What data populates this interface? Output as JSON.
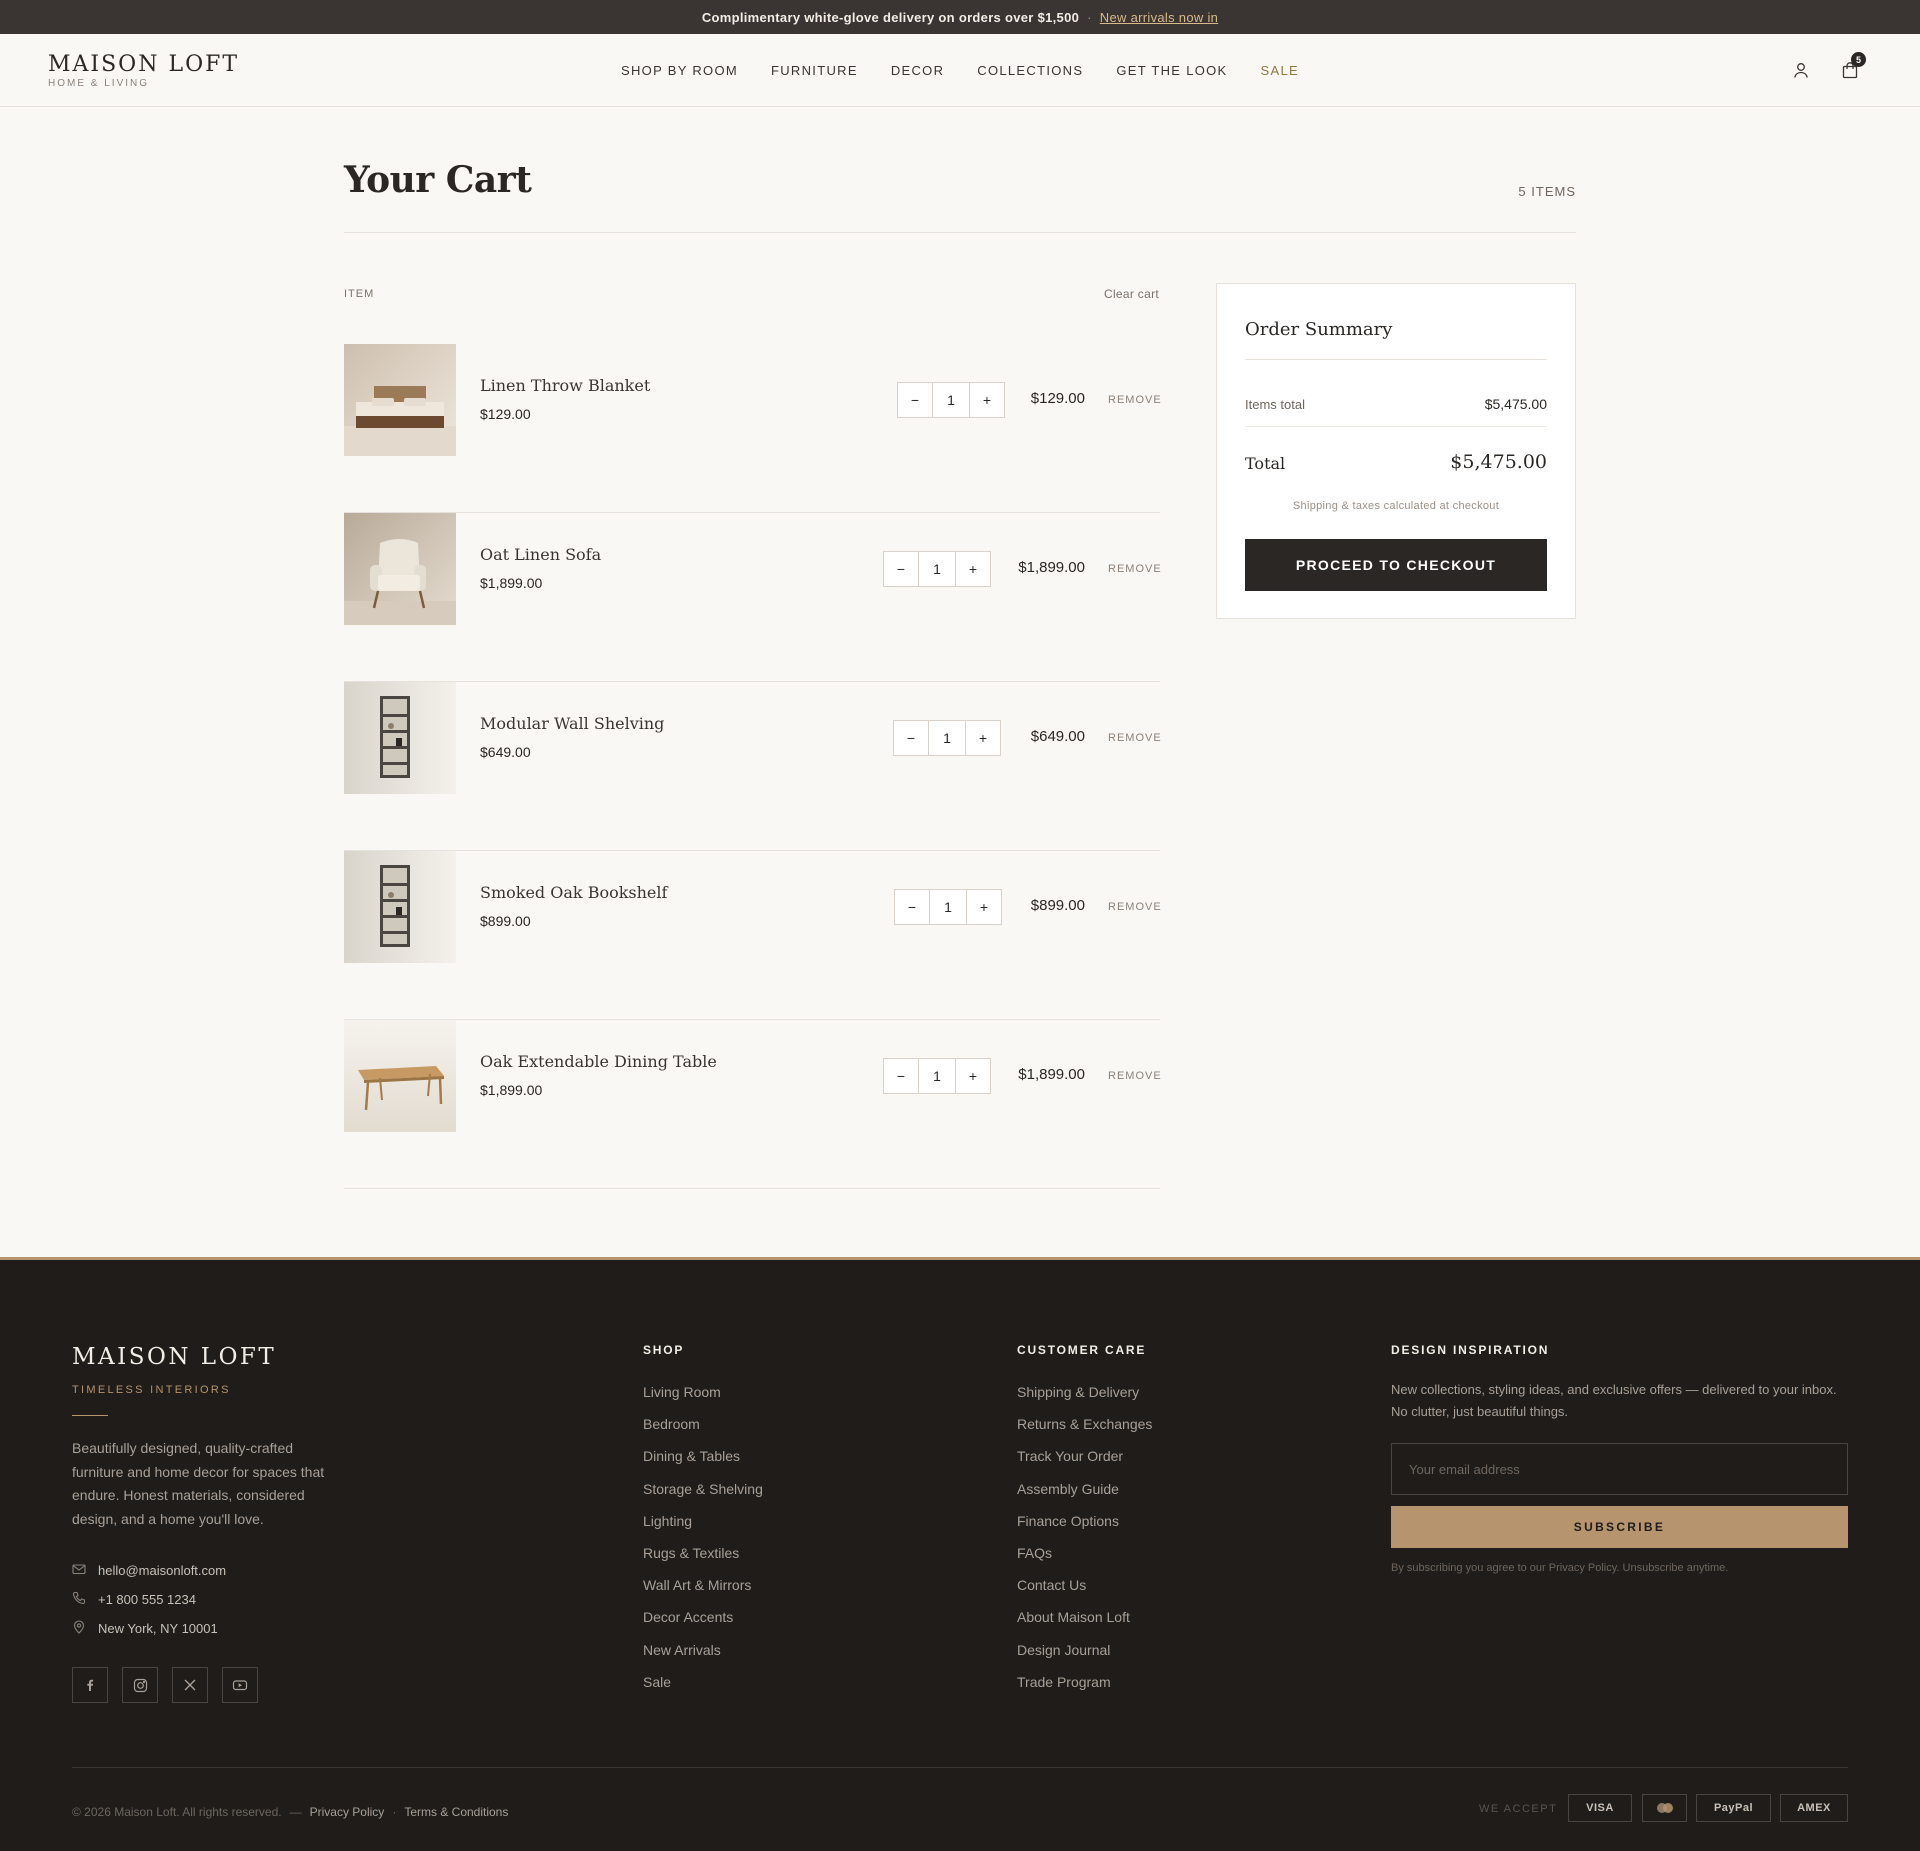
{
  "announcement": {
    "text": "Complimentary white-glove delivery on orders over $1,500",
    "separator": "·",
    "link": "New arrivals now in"
  },
  "header": {
    "brand": "MAISON LOFT",
    "tagline": "HOME & LIVING",
    "nav": [
      "SHOP BY ROOM",
      "FURNITURE",
      "DECOR",
      "COLLECTIONS",
      "GET THE LOOK",
      "SALE"
    ],
    "cart_count": "5",
    "icons": [
      "user-icon",
      "shopping-bag-icon"
    ]
  },
  "cart": {
    "title": "Your Cart",
    "item_count": "5 ITEMS",
    "column_label": "ITEM",
    "clear_label": "Clear cart",
    "remove_label": "REMOVE",
    "items": [
      {
        "name": "Linen Throw Blanket",
        "price": "$129.00",
        "qty": "1",
        "total": "$129.00",
        "image": "bed-photo"
      },
      {
        "name": "Oat Linen Sofa",
        "price": "$1,899.00",
        "qty": "1",
        "total": "$1,899.00",
        "image": "armchair-photo"
      },
      {
        "name": "Modular Wall Shelving",
        "price": "$649.00",
        "qty": "1",
        "total": "$649.00",
        "image": "shelving-photo"
      },
      {
        "name": "Smoked Oak Bookshelf",
        "price": "$899.00",
        "qty": "1",
        "total": "$899.00",
        "image": "shelving-photo"
      },
      {
        "name": "Oak Extendable Dining Table",
        "price": "$1,899.00",
        "qty": "1",
        "total": "$1,899.00",
        "image": "table-photo"
      }
    ],
    "minus": "−",
    "plus": "+"
  },
  "summary": {
    "title": "Order Summary",
    "items_total_label": "Items total",
    "items_total": "$5,475.00",
    "total_label": "Total",
    "total": "$5,475.00",
    "note": "Shipping & taxes calculated at checkout",
    "checkout_label": "PROCEED TO CHECKOUT"
  },
  "footer": {
    "brand": "MAISON LOFT",
    "tagline": "TIMELESS INTERIORS",
    "description": "Beautifully designed, quality-crafted furniture and home decor for spaces that endure. Honest materials, considered design, and a home you'll love.",
    "email": "hello@maisonloft.com",
    "phone": "+1 800 555 1234",
    "location": "New York, NY 10001",
    "social": [
      "facebook-icon",
      "instagram-icon",
      "x-icon",
      "youtube-icon"
    ],
    "shop": {
      "title": "SHOP",
      "links": [
        "Living Room",
        "Bedroom",
        "Dining & Tables",
        "Storage & Shelving",
        "Lighting",
        "Rugs & Textiles",
        "Wall Art & Mirrors",
        "Decor Accents",
        "New Arrivals",
        "Sale"
      ]
    },
    "care": {
      "title": "CUSTOMER CARE",
      "links": [
        "Shipping & Delivery",
        "Returns & Exchanges",
        "Track Your Order",
        "Assembly Guide",
        "Finance Options",
        "FAQs",
        "Contact Us",
        "About Maison Loft",
        "Design Journal",
        "Trade Program"
      ]
    },
    "newsletter": {
      "title": "DESIGN INSPIRATION",
      "description": "New collections, styling ideas, and exclusive offers — delivered to your inbox. No clutter, just beautiful things.",
      "placeholder": "Your email address",
      "button": "SUBSCRIBE",
      "note": "By subscribing you agree to our Privacy Policy. Unsubscribe anytime."
    },
    "copyright": "© 2026 Maison Loft. All rights reserved.",
    "dash": "—",
    "privacy": "Privacy Policy",
    "dot": "·",
    "terms": "Terms & Conditions",
    "we_accept": "WE ACCEPT",
    "payments": [
      "VISA",
      "PayPal",
      "AMEX"
    ]
  },
  "colors": {
    "accent": "#b6946e",
    "dark": "#2a2724",
    "footer_bg": "#1f1c1a",
    "background": "#faf8f5"
  }
}
